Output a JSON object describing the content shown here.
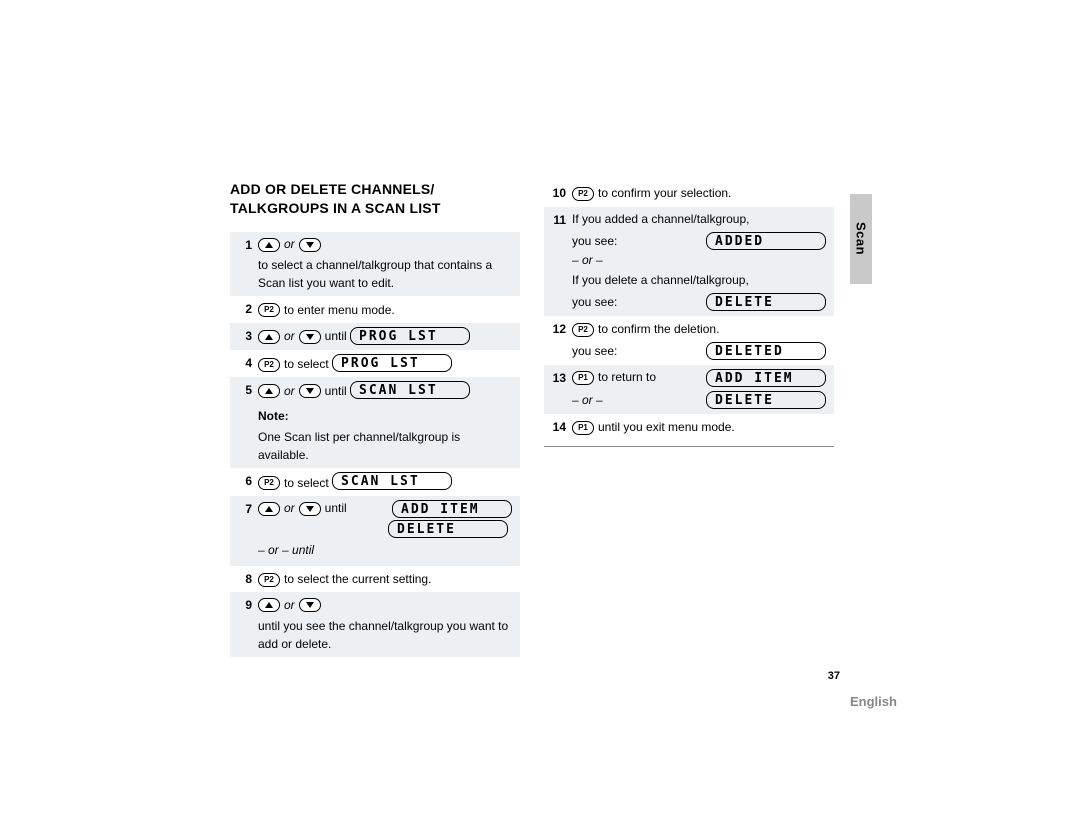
{
  "title": "ADD OR DELETE CHANNELS/ TALKGROUPS IN A SCAN LIST",
  "side_tab": "Scan",
  "page_number": "37",
  "language": "English",
  "labels": {
    "or": "or",
    "until": "until",
    "or_dash": "– or –",
    "or_until": "– or – until",
    "note": "Note:",
    "you_see": "you see:",
    "p1": "P1",
    "p2": "P2"
  },
  "left_steps": [
    {
      "n": "1",
      "type": "arrows_text",
      "text": "to select a channel/talkgroup that contains a Scan list you want to edit."
    },
    {
      "n": "2",
      "type": "p2_text",
      "text": "to enter menu mode."
    },
    {
      "n": "3",
      "type": "arrows_until_lcd",
      "lcd": "PROG LST"
    },
    {
      "n": "4",
      "type": "p2_text_lcd",
      "text": "to select",
      "lcd": "PROG LST"
    },
    {
      "n": "5",
      "type": "arrows_until_lcd",
      "lcd": "SCAN LST"
    },
    {
      "n": "",
      "type": "note",
      "text": "One Scan list per channel/talkgroup is available."
    },
    {
      "n": "6",
      "type": "p2_text_lcd",
      "text": "to select",
      "lcd": "SCAN LST"
    },
    {
      "n": "7",
      "type": "arrows_until_lcd_extra",
      "lcd": "ADD ITEM",
      "lcd2": "DELETE"
    },
    {
      "n": "8",
      "type": "p2_text",
      "text": "to select the current setting."
    },
    {
      "n": "9",
      "type": "arrows_text",
      "text": "until you see the channel/talkgroup you want to add or delete."
    }
  ],
  "right_steps": [
    {
      "n": "10",
      "type": "p2_text",
      "text": "to confirm your selection."
    },
    {
      "n": "11",
      "type": "added_deleted",
      "line1": "If you added a channel/talkgroup,",
      "lcd1": "ADDED",
      "line2": "If you delete a channel/talkgroup,",
      "lcd2": "DELETE"
    },
    {
      "n": "12",
      "type": "p2_deleted",
      "text": "to confirm the deletion.",
      "lcd": "DELETED"
    },
    {
      "n": "13",
      "type": "p1_return",
      "text": "to return to",
      "lcd1": "ADD ITEM",
      "lcd2": "DELETE"
    },
    {
      "n": "14",
      "type": "p1_text",
      "text": "until you exit menu mode."
    }
  ]
}
